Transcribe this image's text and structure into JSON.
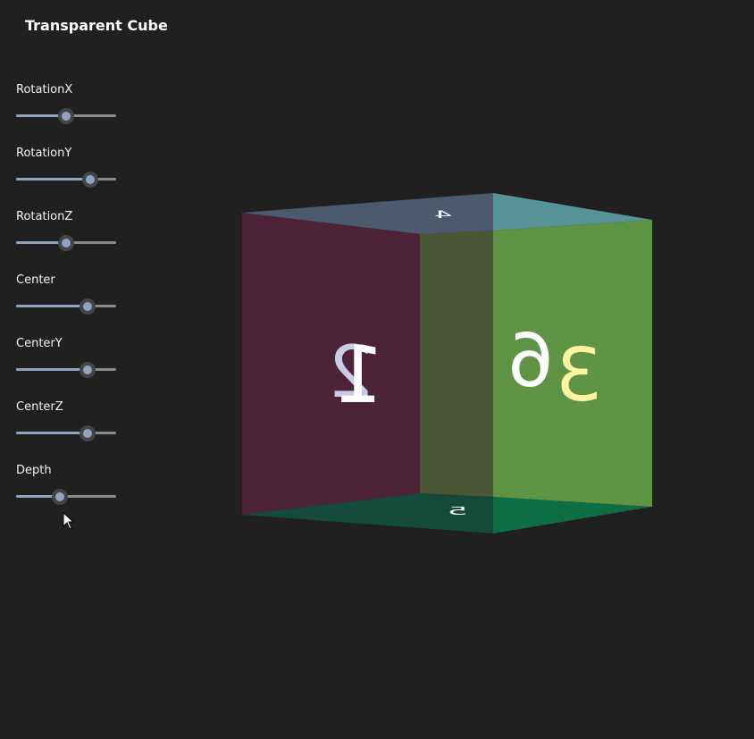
{
  "window": {
    "title": "Transparent Cube"
  },
  "sliders": [
    {
      "id": "rotation-x",
      "label": "RotationX",
      "value": 0.5
    },
    {
      "id": "rotation-y",
      "label": "RotationY",
      "value": 0.74
    },
    {
      "id": "rotation-z",
      "label": "RotationZ",
      "value": 0.5
    },
    {
      "id": "center",
      "label": "Center",
      "value": 0.71
    },
    {
      "id": "center-y",
      "label": "CenterY",
      "value": 0.71
    },
    {
      "id": "center-z",
      "label": "CenterZ",
      "value": 0.71
    },
    {
      "id": "depth",
      "label": "Depth",
      "value": 0.44
    }
  ],
  "cube": {
    "faces": {
      "left": {
        "label": "1",
        "color": "#5a2138"
      },
      "back": {
        "label": "2",
        "color": "#4b5736"
      },
      "right": {
        "label": "6",
        "color": "#5e9444"
      },
      "right_back": {
        "label": "3",
        "color": "#5e9444"
      },
      "top": {
        "label": "4",
        "color": "#4c5a70"
      },
      "bottom": {
        "label": "5",
        "color": "#134a3a"
      }
    },
    "text_colors": {
      "face_1": "#ffffff",
      "face_2": "#c6cde4",
      "face_6": "#ffffff",
      "face_3": "#fff4a0"
    }
  },
  "colors": {
    "background": "#202020",
    "accent": "#8fa3c2"
  }
}
